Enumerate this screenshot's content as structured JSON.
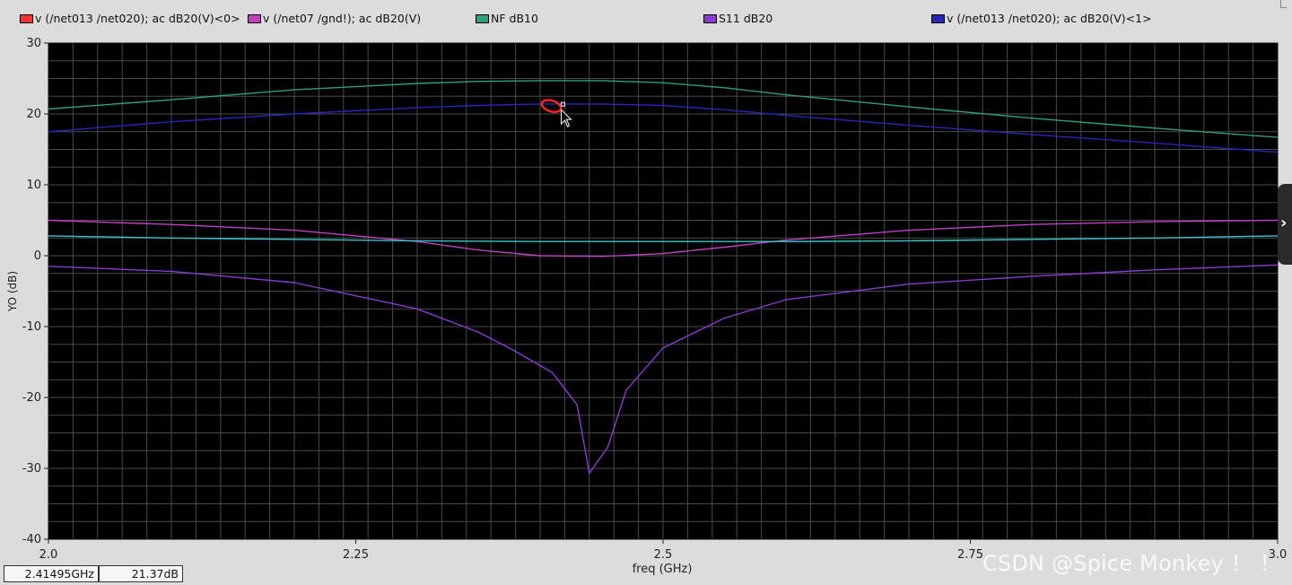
{
  "legend": [
    {
      "label": "v (/net013 /net020); ac dB20(V)<0>",
      "color": "#ff3030"
    },
    {
      "label": "v (/net07 /gnd!); ac dB20(V)",
      "color": "#c040c0"
    },
    {
      "label": "NF dB10",
      "color": "#2e9e7c"
    },
    {
      "label": "S11 dB20",
      "color": "#8a3ad0"
    },
    {
      "label": "v (/net013 /net020); ac dB20(V)<1>",
      "color": "#2626b8"
    }
  ],
  "readout": {
    "freq": "2.41495GHz",
    "value": "21.37dB"
  },
  "watermark": "CSDN @Spice Monkey ！ ！",
  "side_tab_icon": "chevron-right-icon",
  "chart_data": {
    "type": "line",
    "xlabel": "freq (GHz)",
    "ylabel": "YO (dB)",
    "xlim": [
      2.0,
      3.0
    ],
    "ylim": [
      -40,
      30
    ],
    "x_ticks": [
      2.0,
      2.25,
      2.5,
      2.75,
      3.0
    ],
    "x_tick_labels": [
      "2.0",
      "2.25",
      "2.5",
      "2.75",
      "3.0"
    ],
    "y_ticks": [
      30,
      20,
      10,
      0,
      -10,
      -20,
      -30,
      -40
    ],
    "y_tick_labels": [
      "30",
      "20",
      "10",
      "0",
      "-10",
      "-20",
      "-30",
      "-40"
    ],
    "grid": true,
    "background": "#000000",
    "grid_color": "#4a4a4a",
    "series": [
      {
        "name": "NF dB10",
        "color": "#2e9e7c",
        "x": [
          2.0,
          2.1,
          2.2,
          2.3,
          2.35,
          2.4,
          2.45,
          2.5,
          2.55,
          2.6,
          2.7,
          2.8,
          2.9,
          3.0
        ],
        "y": [
          20.7,
          22.0,
          23.4,
          24.3,
          24.6,
          24.7,
          24.7,
          24.4,
          23.7,
          22.7,
          21.0,
          19.4,
          18.0,
          16.7
        ]
      },
      {
        "name": "v (/net013 /net020); ac dB20(V)<1>",
        "color": "#2626b8",
        "x": [
          2.0,
          2.1,
          2.2,
          2.3,
          2.35,
          2.4,
          2.45,
          2.5,
          2.55,
          2.6,
          2.7,
          2.8,
          2.9,
          3.0
        ],
        "y": [
          17.5,
          18.9,
          20.0,
          20.9,
          21.2,
          21.4,
          21.4,
          21.2,
          20.6,
          19.8,
          18.4,
          17.1,
          15.9,
          14.6
        ]
      },
      {
        "name": "v (/net07 /gnd!); ac dB20(V)",
        "color": "#c040c0",
        "x": [
          2.0,
          2.1,
          2.2,
          2.3,
          2.35,
          2.4,
          2.45,
          2.5,
          2.55,
          2.6,
          2.7,
          2.8,
          2.9,
          3.0
        ],
        "y": [
          5.0,
          4.4,
          3.6,
          2.0,
          0.8,
          0.0,
          -0.1,
          0.3,
          1.2,
          2.2,
          3.6,
          4.4,
          4.8,
          5.0
        ]
      },
      {
        "name": "S11 dB20",
        "color": "#8a3ad0",
        "x": [
          2.0,
          2.1,
          2.2,
          2.3,
          2.35,
          2.38,
          2.41,
          2.43,
          2.44,
          2.455,
          2.47,
          2.5,
          2.55,
          2.6,
          2.7,
          2.8,
          2.9,
          3.0
        ],
        "y": [
          -1.5,
          -2.2,
          -3.8,
          -7.5,
          -10.8,
          -13.5,
          -16.5,
          -21.0,
          -30.7,
          -27.0,
          -19.0,
          -13.0,
          -8.8,
          -6.2,
          -4.0,
          -2.9,
          -2.0,
          -1.3
        ]
      },
      {
        "name": "v (/net013 /net020); ac dB20(V)<0>",
        "color": "#37c3c8",
        "x": [
          2.0,
          2.1,
          2.2,
          2.3,
          2.4,
          2.5,
          2.6,
          2.7,
          2.8,
          2.9,
          3.0
        ],
        "y": [
          2.8,
          2.5,
          2.3,
          2.1,
          2.0,
          2.0,
          2.0,
          2.1,
          2.3,
          2.5,
          2.8
        ]
      }
    ],
    "marker": {
      "x": 2.41495,
      "y": 21.37
    }
  }
}
